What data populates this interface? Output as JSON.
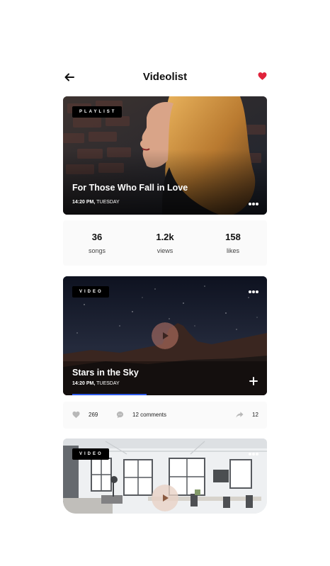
{
  "header": {
    "title": "Videolist",
    "back_icon": "arrow-left-icon",
    "favorite_icon": "heart-icon",
    "favorite_color": "#e0233b"
  },
  "playlist_card": {
    "badge": "PLAYLIST",
    "title": "For Those Who Fall in Love",
    "time": "14:20 PM,",
    "day": "TUESDAY",
    "menu_icon": "more-dots-icon"
  },
  "stats": [
    {
      "value": "36",
      "label": "songs"
    },
    {
      "value": "1.2k",
      "label": "views"
    },
    {
      "value": "158",
      "label": "likes"
    }
  ],
  "video_card": {
    "badge": "VIDEO",
    "title": "Stars in the Sky",
    "time": "14:20 PM,",
    "day": "TUESDAY",
    "menu_icon": "more-dots-icon",
    "play_icon": "play-icon",
    "add_icon": "plus-icon",
    "progress": 0.4,
    "progress_color": "#2f5bea"
  },
  "actions": {
    "likes": "269",
    "comments": "12 comments",
    "shares": "12",
    "like_icon": "heart-icon",
    "comment_icon": "comment-icon",
    "share_icon": "share-icon"
  },
  "video_card_2": {
    "badge": "VIDEO",
    "menu_icon": "more-dots-icon",
    "play_icon": "play-icon"
  }
}
